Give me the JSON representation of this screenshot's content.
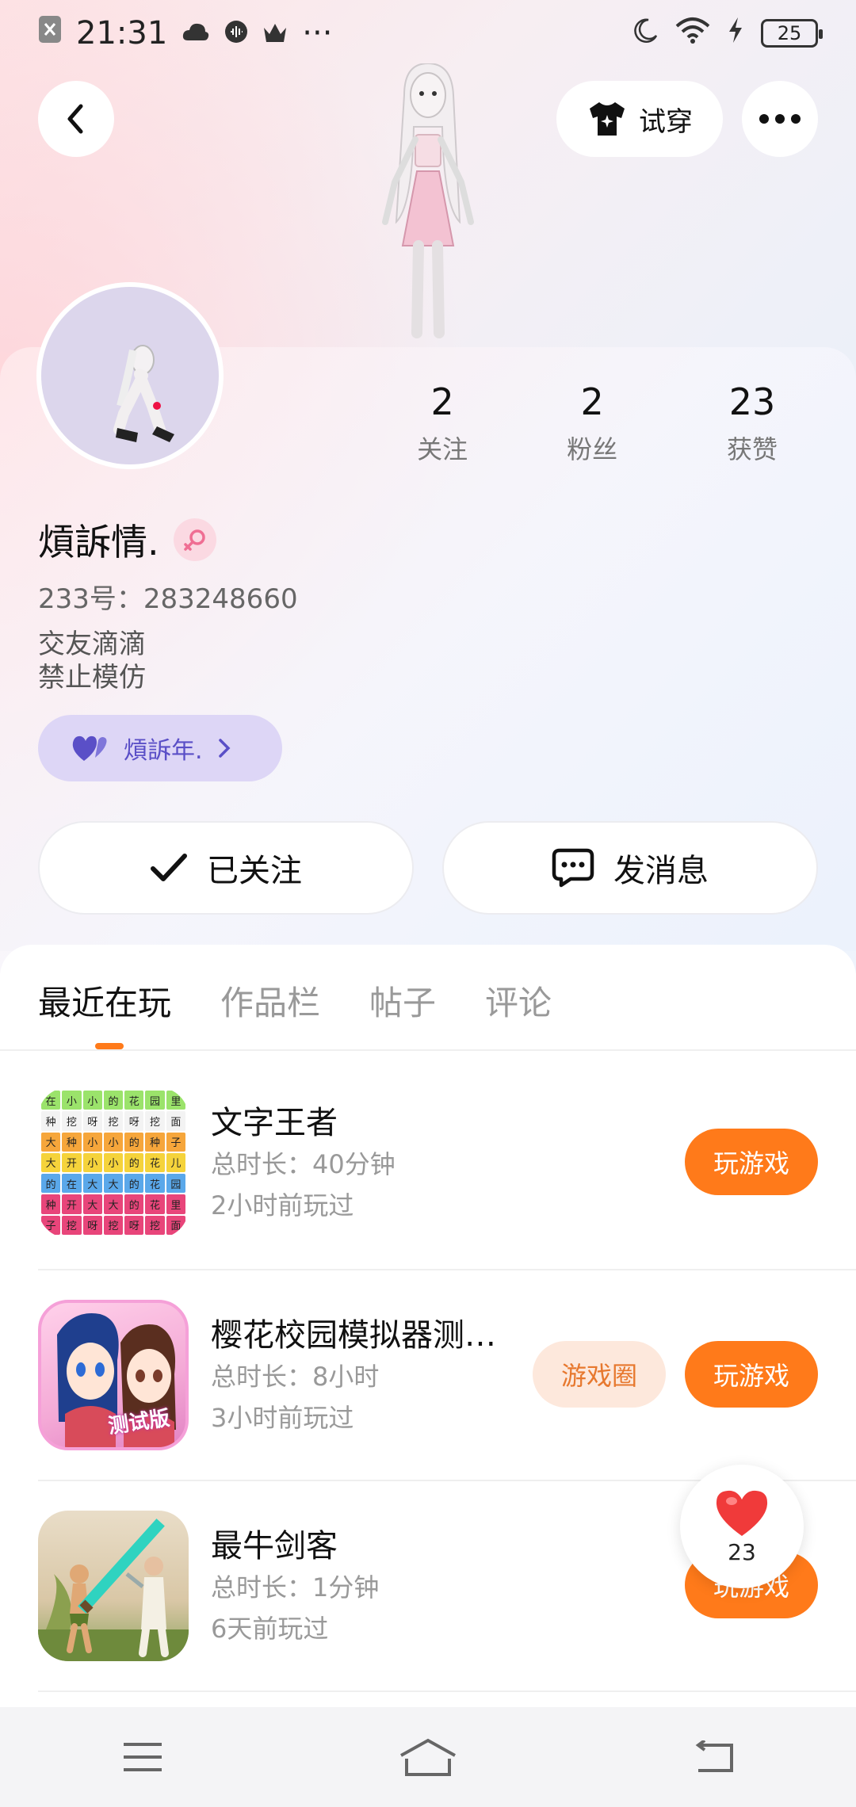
{
  "status_bar": {
    "time": "21:31",
    "battery": "25",
    "more": "···"
  },
  "header": {
    "try_on_label": "试穿"
  },
  "profile": {
    "stats": [
      {
        "value": "2",
        "label": "关注"
      },
      {
        "value": "2",
        "label": "粉丝"
      },
      {
        "value": "23",
        "label": "获赞"
      }
    ],
    "name": "熕訴情.",
    "uid": "233号：283248660",
    "bio": [
      "交友滴滴",
      "禁止模仿"
    ],
    "partner_name": "熕訴年."
  },
  "actions": {
    "followed_label": "已关注",
    "message_label": "发消息"
  },
  "tabs": [
    "最近在玩",
    "作品栏",
    "帖子",
    "评论"
  ],
  "games": [
    {
      "title": "文字王者",
      "duration": "总时长：40分钟",
      "last_played": "2小时前玩过",
      "play_label": "玩游戏"
    },
    {
      "title": "樱花校园模拟器测…",
      "duration": "总时长：8小时",
      "last_played": "3小时前玩过",
      "circle_label": "游戏圈",
      "play_label": "玩游戏",
      "icon_badge": "测试版"
    },
    {
      "title": "最牛剑客",
      "duration": "总时长：1分钟",
      "last_played": "6天前玩过",
      "play_label": "玩游戏"
    }
  ],
  "like_fab": {
    "count": "23"
  },
  "word_grid": [
    "在",
    "小",
    "小",
    "的",
    "花",
    "园",
    "里",
    "种",
    "挖",
    "呀",
    "挖",
    "呀",
    "挖",
    "面",
    "大",
    "种",
    "小",
    "小",
    "的",
    "种",
    "子",
    "大",
    "开",
    "小",
    "小",
    "的",
    "花",
    "儿",
    "的",
    "在",
    "大",
    "大",
    "的",
    "花",
    "园",
    "种",
    "开",
    "大",
    "大",
    "的",
    "花",
    "里",
    "子",
    "挖",
    "呀",
    "挖",
    "呀",
    "挖",
    "面"
  ],
  "colors": {
    "accent": "#ff7a1a",
    "partner_bg": "#ddd6f6",
    "partner_text": "#5a4fc7"
  }
}
